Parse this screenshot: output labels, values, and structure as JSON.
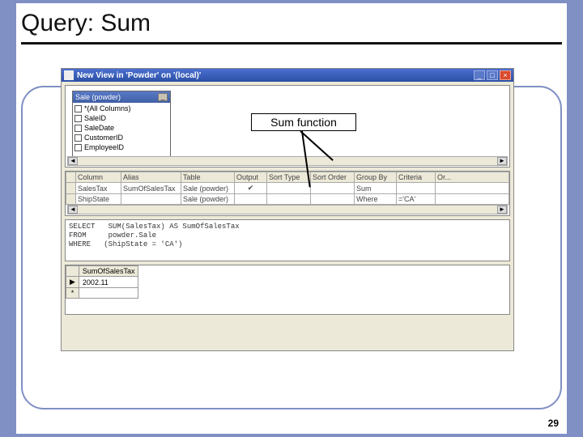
{
  "slide": {
    "title": "Query: Sum",
    "page_number": "29"
  },
  "callout": {
    "label": "Sum function"
  },
  "window": {
    "title": "New View in 'Powder' on '(local)'"
  },
  "diagram": {
    "table_header": "Sale (powder)",
    "columns": [
      "*(All Columns)",
      "SaleID",
      "SaleDate",
      "CustomerID",
      "EmployeeID"
    ]
  },
  "grid": {
    "headers": [
      "Column",
      "Alias",
      "Table",
      "Output",
      "Sort Type",
      "Sort Order",
      "Group By",
      "Criteria",
      "Or..."
    ],
    "rows": [
      {
        "column": "SalesTax",
        "alias": "SumOfSalesTax",
        "table": "Sale (powder)",
        "output_checked": true,
        "sort_type": "",
        "sort_order": "",
        "group_by": "Sum",
        "criteria": "",
        "or": ""
      },
      {
        "column": "ShipState",
        "alias": "",
        "table": "Sale (powder)",
        "output_checked": false,
        "sort_type": "",
        "sort_order": "",
        "group_by": "Where",
        "criteria": "='CA'",
        "or": ""
      }
    ]
  },
  "sql": {
    "line1": "SELECT   SUM(SalesTax) AS SumOfSalesTax",
    "line2": "FROM     powder.Sale",
    "line3": "WHERE   (ShipState = 'CA')"
  },
  "result": {
    "header": "SumOfSalesTax",
    "value": "2002.11"
  },
  "glyphs": {
    "min": "_",
    "max": "□",
    "close": "×",
    "left": "◄",
    "right": "►",
    "check": "✔",
    "play": "▶",
    "star": "*"
  }
}
